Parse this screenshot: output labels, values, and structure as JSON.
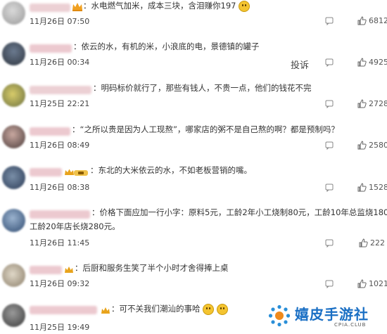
{
  "report_label": "投诉",
  "comments": [
    {
      "text": "水电燃气加米，成本三块，含泪赚你197",
      "time": "11月26日 07:50",
      "likes": "6812"
    },
    {
      "text": "依云的水，有机的米，小浪底的电，景德镇的罐子",
      "time": "11月26日 00:34",
      "likes": "4925"
    },
    {
      "text": "明码标价就行了，那些有钱人，不贵一点，他们的钱花不完",
      "time": "11月25日 22:21",
      "likes": "2728"
    },
    {
      "text": "“之所以贵是因为人工现熬”，哪家店的粥不是自己熬的啊？都是预制吗？",
      "time": "11月26日 08:49",
      "likes": "2580"
    },
    {
      "text": "东北的大米依云的水，不如老板营销的嘴。",
      "time": "11月26日 08:38",
      "likes": "1528"
    },
    {
      "text": "价格下面应加一行小字：原料5元，工龄2年小工烧制80元，工龄10年总监烧180元，",
      "text2": "工龄20年店长烧280元。",
      "time": "11月26日 11:45",
      "likes": "222"
    },
    {
      "text": "后厨和服务生笑了半个小时才舍得捧上桌",
      "time": "11月26日 09:32",
      "likes": "1021"
    },
    {
      "text": "可不关我们潮汕的事哈",
      "time": "11月25日 19:49",
      "likes": ""
    }
  ],
  "watermark": {
    "title": "嬉皮手游社",
    "subtitle": "CPIA.CLUB"
  },
  "colors": {
    "name_blur": "#e9c3c8",
    "like": "#666666",
    "watermark_blue": "#1a6fc4"
  }
}
